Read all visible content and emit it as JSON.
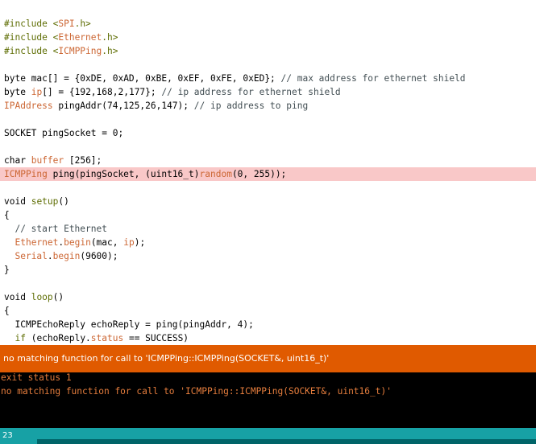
{
  "editor": {
    "lines": [
      [],
      [
        {
          "t": "#include <",
          "c": "p"
        },
        {
          "t": "SPI",
          "c": "k"
        },
        {
          "t": ".h>",
          "c": "p"
        }
      ],
      [
        {
          "t": "#include <",
          "c": "p"
        },
        {
          "t": "Ethernet",
          "c": "k"
        },
        {
          "t": ".h>",
          "c": "p"
        }
      ],
      [
        {
          "t": "#include <",
          "c": "p"
        },
        {
          "t": "ICMPPing",
          "c": "k"
        },
        {
          "t": ".h>",
          "c": "p"
        }
      ],
      [],
      [
        {
          "t": "byte",
          "c": "t"
        },
        {
          "t": " mac[] = {0xDE, 0xAD, 0xBE, 0xEF, 0xFE, 0xED}; ",
          "c": "n"
        },
        {
          "t": "// max address for ethernet shield",
          "c": "c"
        }
      ],
      [
        {
          "t": "byte",
          "c": "t"
        },
        {
          "t": " ",
          "c": "n"
        },
        {
          "t": "ip",
          "c": "k"
        },
        {
          "t": "[] = {192,168,2,177}; ",
          "c": "n"
        },
        {
          "t": "// ip address for ethernet shield",
          "c": "c"
        }
      ],
      [
        {
          "t": "IPAddress",
          "c": "k"
        },
        {
          "t": " pingAddr(74,125,26,147); ",
          "c": "n"
        },
        {
          "t": "// ip address to ping",
          "c": "c"
        }
      ],
      [],
      [
        {
          "t": "SOCKET pingSocket = 0;",
          "c": "n"
        }
      ],
      [],
      [
        {
          "t": "char",
          "c": "t"
        },
        {
          "t": " ",
          "c": "n"
        },
        {
          "t": "buffer",
          "c": "k"
        },
        {
          "t": " [256];",
          "c": "n"
        }
      ],
      [
        {
          "t": "ICMPPing",
          "c": "k"
        },
        {
          "t": " ping(pingSocket, (",
          "c": "n"
        },
        {
          "t": "uint16_t",
          "c": "t"
        },
        {
          "t": ")",
          "c": "n"
        },
        {
          "t": "random",
          "c": "k"
        },
        {
          "t": "(0, 255));",
          "c": "n"
        }
      ],
      [],
      [
        {
          "t": "void",
          "c": "t"
        },
        {
          "t": " ",
          "c": "n"
        },
        {
          "t": "setup",
          "c": "p"
        },
        {
          "t": "()",
          "c": "n"
        }
      ],
      [
        {
          "t": "{",
          "c": "n"
        }
      ],
      [
        {
          "t": "  // start Ethernet",
          "c": "c"
        }
      ],
      [
        {
          "t": "  ",
          "c": "n"
        },
        {
          "t": "Ethernet",
          "c": "k"
        },
        {
          "t": ".",
          "c": "n"
        },
        {
          "t": "begin",
          "c": "k"
        },
        {
          "t": "(mac, ",
          "c": "n"
        },
        {
          "t": "ip",
          "c": "k"
        },
        {
          "t": ");",
          "c": "n"
        }
      ],
      [
        {
          "t": "  ",
          "c": "n"
        },
        {
          "t": "Serial",
          "c": "k"
        },
        {
          "t": ".",
          "c": "n"
        },
        {
          "t": "begin",
          "c": "k"
        },
        {
          "t": "(9600);",
          "c": "n"
        }
      ],
      [
        {
          "t": "}",
          "c": "n"
        }
      ],
      [],
      [
        {
          "t": "void",
          "c": "t"
        },
        {
          "t": " ",
          "c": "n"
        },
        {
          "t": "loop",
          "c": "p"
        },
        {
          "t": "()",
          "c": "n"
        }
      ],
      [
        {
          "t": "{",
          "c": "n"
        }
      ],
      [
        {
          "t": "  ICMPEchoReply echoReply = ping(pingAddr, 4);",
          "c": "n"
        }
      ],
      [
        {
          "t": "  ",
          "c": "n"
        },
        {
          "t": "if",
          "c": "p"
        },
        {
          "t": " (echoReply.",
          "c": "n"
        },
        {
          "t": "status",
          "c": "k"
        },
        {
          "t": " == SUCCESS)",
          "c": "n"
        }
      ]
    ],
    "highlighted_line": 12,
    "highlight_color": "#f9c8c8"
  },
  "error_bar": {
    "message": "no matching function for call to 'ICMPPing::ICMPPing(SOCKET&, uint16_t)'",
    "color": "#e05a00"
  },
  "console": {
    "lines": [
      "exit status 1",
      "no matching function for call to 'ICMPPing::ICMPPing(SOCKET&, uint16_t)'"
    ],
    "text_color": "#e57d3d"
  },
  "status_bar": {
    "line_number": "23",
    "color": "#17a1a5"
  }
}
